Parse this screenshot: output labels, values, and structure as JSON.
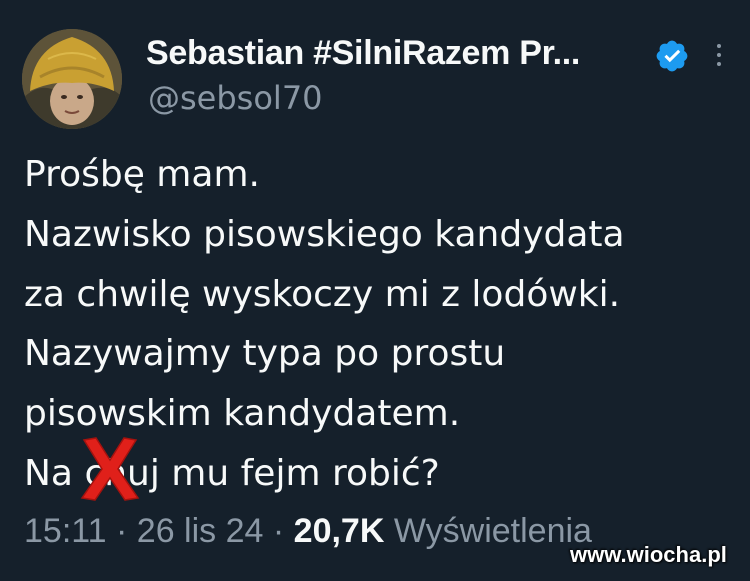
{
  "tweet": {
    "author_name": "Sebastian #SilniRazem Pr...",
    "handle": "@sebsol70",
    "lines": [
      "Prośbę mam.",
      "Nazwisko pisowskiego kandydata",
      "za chwilę wyskoczy mi z lodówki.",
      "Nazywajmy typa po prostu",
      "pisowskim kandydatem."
    ],
    "last_line": {
      "before": "Na ",
      "censored": "ch",
      "after": "uj mu fejm robić?"
    },
    "time": "15:11",
    "date": "26 lis 24",
    "separator": "·",
    "views_count": "20,7K",
    "views_label": "Wyświetlenia"
  },
  "watermark": "www.wiocha.pl",
  "icons": {
    "verified": "verified-badge-icon",
    "more": "more-options-icon",
    "censor": "red-x-mark"
  },
  "colors": {
    "background": "#15202b",
    "text": "#f7f9f9",
    "secondary": "#8b98a5",
    "verified": "#1d9bf0",
    "censor": "#e0201a"
  }
}
